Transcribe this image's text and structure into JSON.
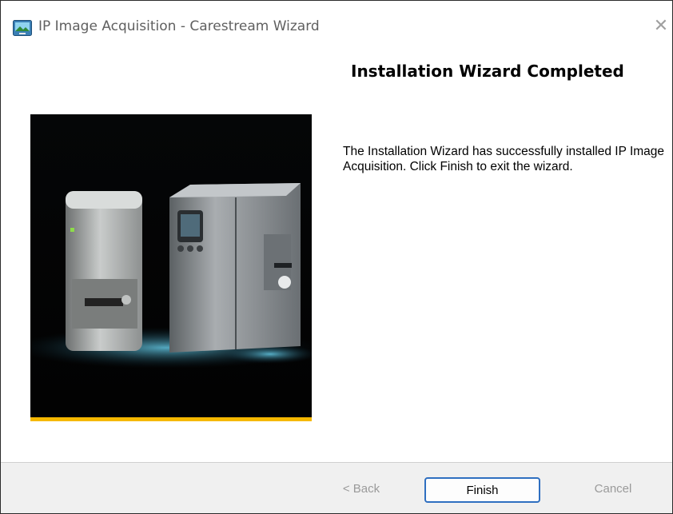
{
  "window": {
    "title": "IP Image Acquisition - Carestream Wizard",
    "close_glyph": "✕",
    "icon": "installer-icon"
  },
  "content": {
    "heading": "Installation Wizard Completed",
    "message": "The Installation Wizard has successfully installed IP Image Acquisition. Click Finish to exit the wizard.",
    "image": "product-devices-image"
  },
  "footer": {
    "back_label": "< Back",
    "finish_label": "Finish",
    "cancel_label": "Cancel"
  },
  "colors": {
    "accent_border": "#2f6fc0",
    "image_stripe": "#f5b800",
    "disabled_text": "#9a9a9a"
  }
}
